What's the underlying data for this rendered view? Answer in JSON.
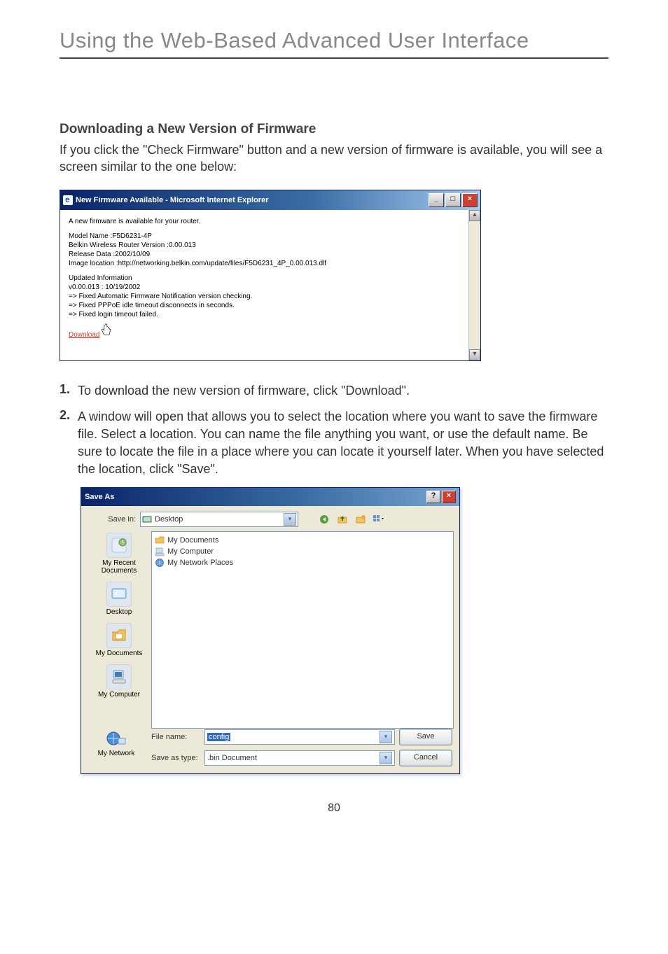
{
  "page": {
    "main_heading": "Using the Web-Based Advanced User Interface",
    "sub_heading": "Downloading a New Version of Firmware",
    "intro_text": "If you click the \"Check Firmware\" button and a new version of firmware is available, you will see a screen similar to the one below:",
    "page_number": "80"
  },
  "steps": {
    "s1_num": "1.",
    "s1_text": "To download the new version of firmware, click \"Download\".",
    "s2_num": "2.",
    "s2_text": "A window will open that allows you to select the location where you want to save the firmware file. Select a location. You can name the file anything you want, or use the default name. Be sure to locate the file in a place where you can locate it yourself later. When you have selected the location, click \"Save\"."
  },
  "ie": {
    "title": "New Firmware Available - Microsoft Internet Explorer",
    "line_avail": "A new firmware is available for your router.",
    "model": "Model Name :F5D6231-4P",
    "version": "Belkin Wireless Router Version :0.00.013",
    "release": "Release Data :2002/10/09",
    "image_loc": "Image location :http://networking.belkin.com/update/files/F5D6231_4P_0.00.013.dlf",
    "upd_head": "Updated Information",
    "upd_ver": "v0.00.013 : 10/19/2002",
    "upd_l1": "=> Fixed Automatic Firmware Notification version checking.",
    "upd_l2": "=> Fixed PPPoE idle timeout disconnects in seconds.",
    "upd_l3": "=> Fixed login timeout failed.",
    "download": "Download"
  },
  "saveas": {
    "title": "Save As",
    "savein_label": "Save in:",
    "savein_value": "Desktop",
    "list_mydocs": "My Documents",
    "list_mycomp": "My Computer",
    "list_mynet": "My Network Places",
    "place_recent": "My Recent Documents",
    "place_desktop": "Desktop",
    "place_mydocs": "My Documents",
    "place_mycomp": "My Computer",
    "place_mynet": "My Network",
    "filename_label": "File name:",
    "filename_value": "config",
    "savetype_label": "Save as type:",
    "savetype_value": ".bin Document",
    "btn_save": "Save",
    "btn_cancel": "Cancel"
  }
}
